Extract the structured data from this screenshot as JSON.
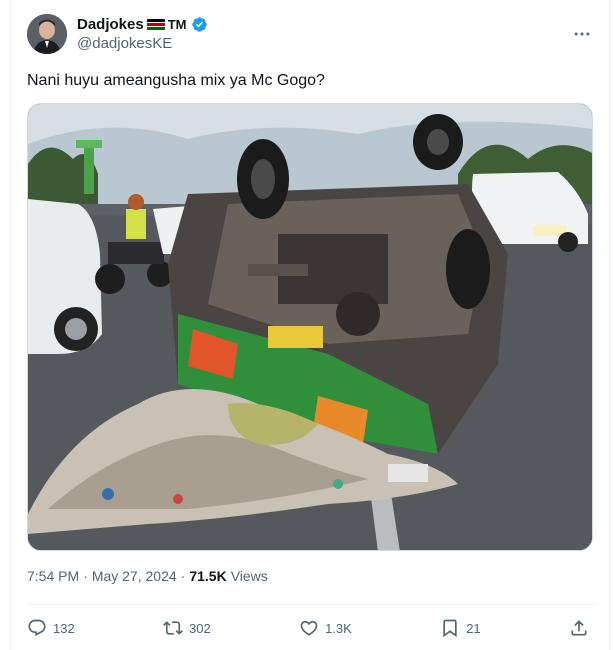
{
  "author": {
    "display_name": "Dadjokes",
    "suffix": "TM",
    "handle": "@dadjokesKE",
    "verified": true,
    "flag": "kenya"
  },
  "tweet": {
    "text": "Nani huyu ameangusha mix ya Mc Gogo?",
    "image_alt": "Overturned green matatu with spilled garbage on the road"
  },
  "meta": {
    "time": "7:54 PM",
    "separator": "·",
    "date": "May 27, 2024",
    "views_count": "71.5K",
    "views_label": "Views"
  },
  "actions": {
    "replies": "132",
    "reposts": "302",
    "likes": "1.3K",
    "bookmarks": "21"
  },
  "icons": {
    "more": "more-icon",
    "reply": "reply-icon",
    "repost": "repost-icon",
    "like": "like-icon",
    "bookmark": "bookmark-icon",
    "share": "share-icon"
  },
  "colors": {
    "verified": "#1d9bf0",
    "secondary_text": "#536471",
    "primary_text": "#0f1419"
  }
}
